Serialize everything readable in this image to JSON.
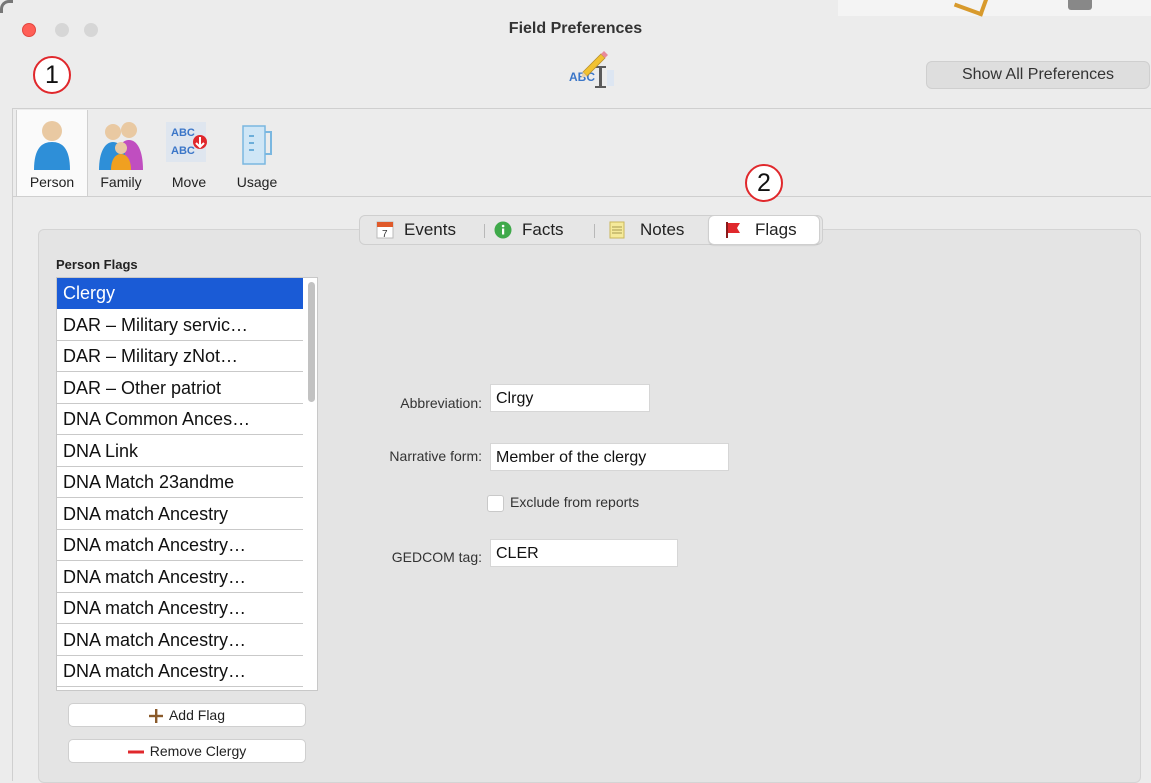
{
  "window": {
    "title": "Field Preferences"
  },
  "markers": {
    "one": "1",
    "two": "2"
  },
  "header": {
    "show_all_label": "Show All Preferences",
    "icon": "abc-spelling-pencil-icon"
  },
  "toolbar": {
    "items": [
      {
        "label": "Person",
        "icon": "person-icon",
        "selected": true
      },
      {
        "label": "Family",
        "icon": "family-icon"
      },
      {
        "label": "Move",
        "icon": "move-abc-icon"
      },
      {
        "label": "Usage",
        "icon": "usage-jar-icon"
      }
    ]
  },
  "tabs": [
    {
      "label": "Events",
      "icon": "calendar-icon"
    },
    {
      "label": "Facts",
      "icon": "info-icon"
    },
    {
      "label": "Notes",
      "icon": "notepad-icon"
    },
    {
      "label": "Flags",
      "icon": "flag-icon",
      "selected": true
    }
  ],
  "flags": {
    "title": "Person Flags",
    "items": [
      "Clergy",
      "DAR – Military servic…",
      "DAR – Military zNot…",
      "DAR – Other patriot",
      "DNA Common Ances…",
      "DNA Link",
      "DNA Match 23andme",
      "DNA match Ancestry",
      "DNA match Ancestry…",
      "DNA match Ancestry…",
      "DNA match Ancestry…",
      "DNA match Ancestry…",
      "DNA match Ancestry…"
    ],
    "selected_index": 0,
    "add_label": "Add Flag",
    "remove_label": "Remove Clergy"
  },
  "form": {
    "abbreviation_label": "Abbreviation:",
    "abbreviation_value": "Clrgy",
    "narrative_label": "Narrative form:",
    "narrative_value": "Member of the clergy",
    "exclude_label": "Exclude from reports",
    "exclude_checked": false,
    "gedcom_label": "GEDCOM tag:",
    "gedcom_value": "CLER"
  },
  "colors": {
    "selection": "#1a5bd6",
    "badge_border": "#e0282c",
    "flag_red": "#e0282c"
  }
}
